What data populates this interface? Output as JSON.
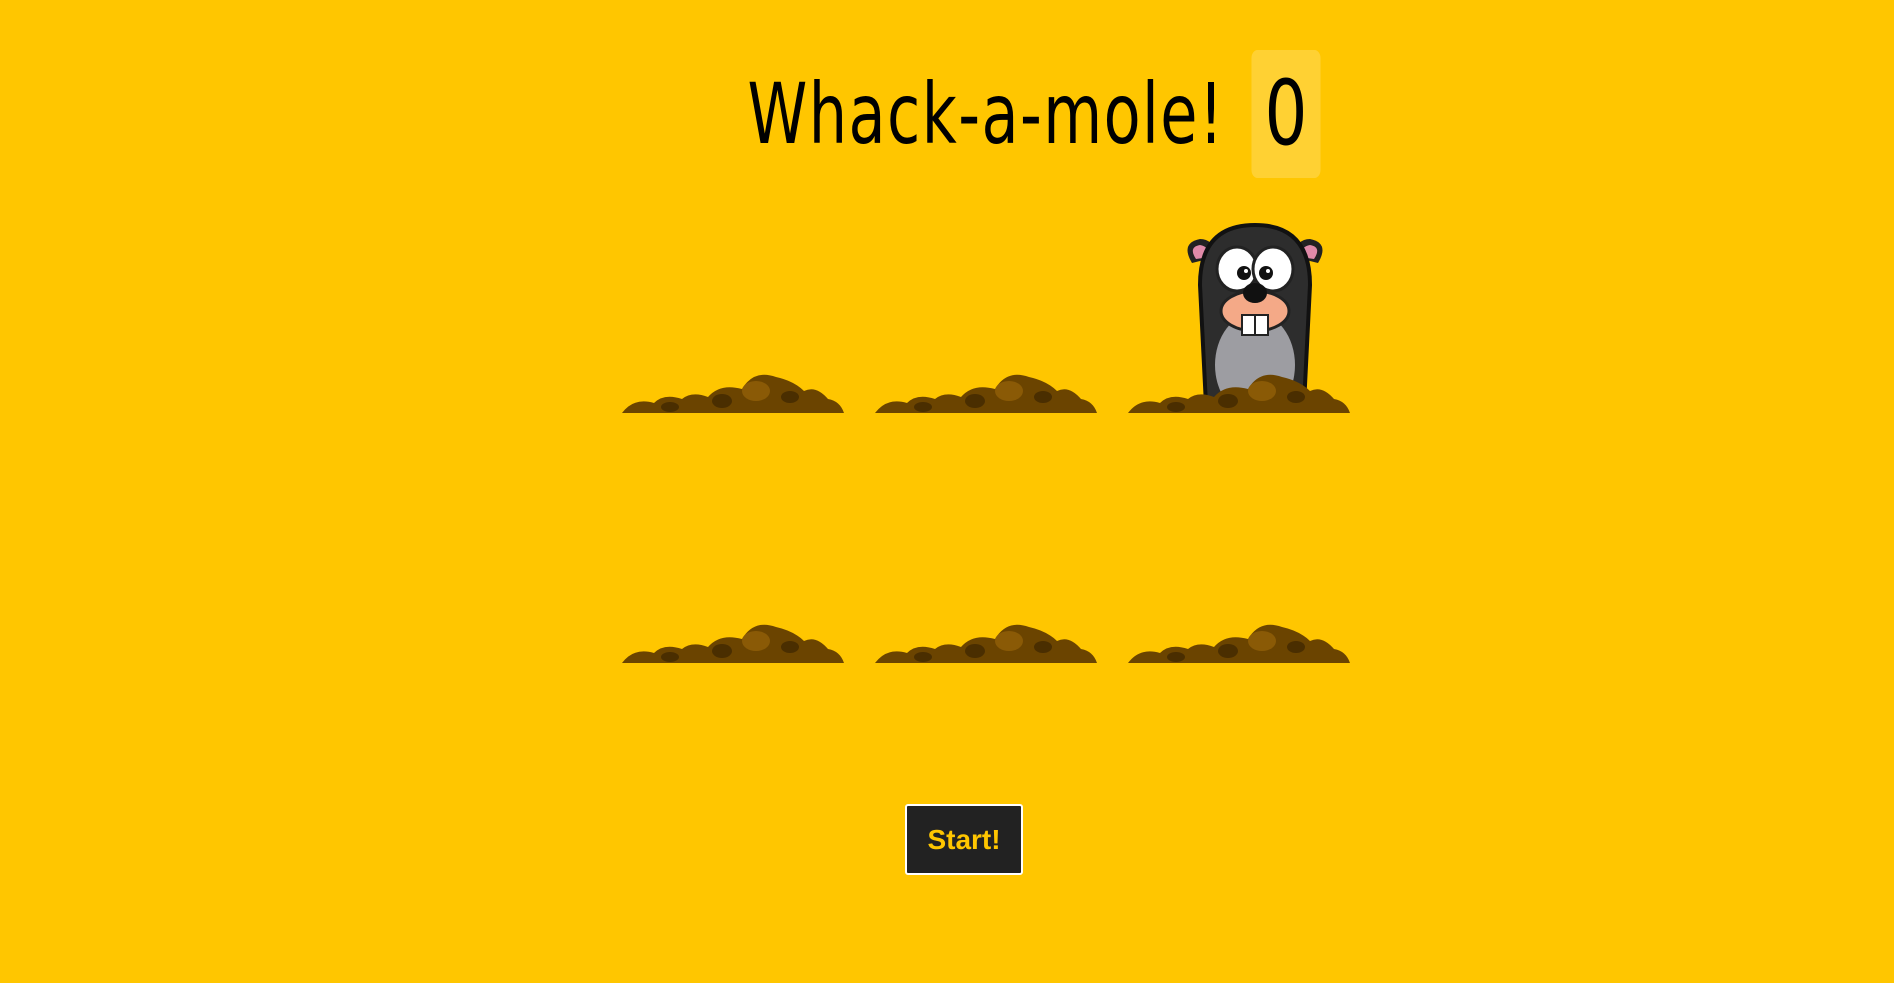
{
  "header": {
    "title": "Whack-a-mole!",
    "score": "0"
  },
  "holes": [
    {
      "mole_up": false
    },
    {
      "mole_up": false
    },
    {
      "mole_up": true
    },
    {
      "mole_up": false
    },
    {
      "mole_up": false
    },
    {
      "mole_up": false
    }
  ],
  "controls": {
    "start_label": "Start!"
  },
  "colors": {
    "background": "#ffc600",
    "button_bg": "#222222",
    "button_text": "#ffc600",
    "dirt": "#6b4400"
  },
  "icons": {
    "mole": "mole-icon",
    "dirt": "dirt-mound-icon"
  }
}
